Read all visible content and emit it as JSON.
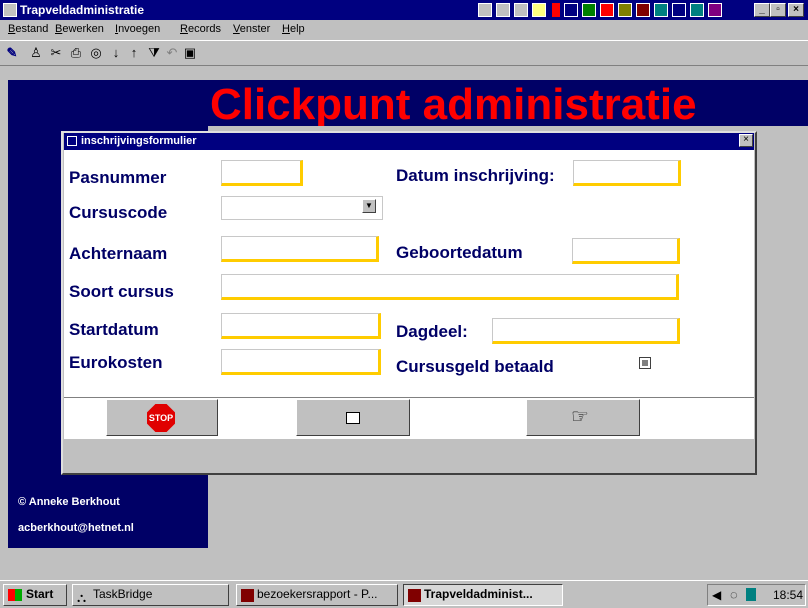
{
  "window": {
    "title": "Trapveldadministratie"
  },
  "menu": [
    "Bestand",
    "Bewerken",
    "Invoegen",
    "Records",
    "Venster",
    "Help"
  ],
  "background": {
    "heading": "Clickpunt administratie",
    "copyright": "© Anneke Berkhout",
    "email": "acberkhout@hetnet.nl"
  },
  "dialog": {
    "title": "inschrijvingsformulier",
    "labels": {
      "pasnummer": "Pasnummer",
      "cursuscode": "Cursuscode",
      "achternaam": "Achternaam",
      "soort_cursus": "Soort cursus",
      "startdatum": "Startdatum",
      "eurokosten": "Eurokosten",
      "datum_inschrijving": "Datum inschrijving:",
      "geboortedatum": "Geboortedatum",
      "dagdeel": "Dagdeel:",
      "cursusgeld_betaald": "Cursusgeld betaald"
    },
    "buttons": {
      "stop": "STOP"
    }
  },
  "taskbar": {
    "start": "Start",
    "tasks": [
      "TaskBridge",
      "bezoekersrapport - P...",
      "Trapveldadminist..."
    ],
    "clock": "18:54"
  },
  "colors": {
    "title_bar": "#000080",
    "label": "#000066",
    "heading": "#ff0000",
    "field_shadow": "#ffcc00"
  }
}
